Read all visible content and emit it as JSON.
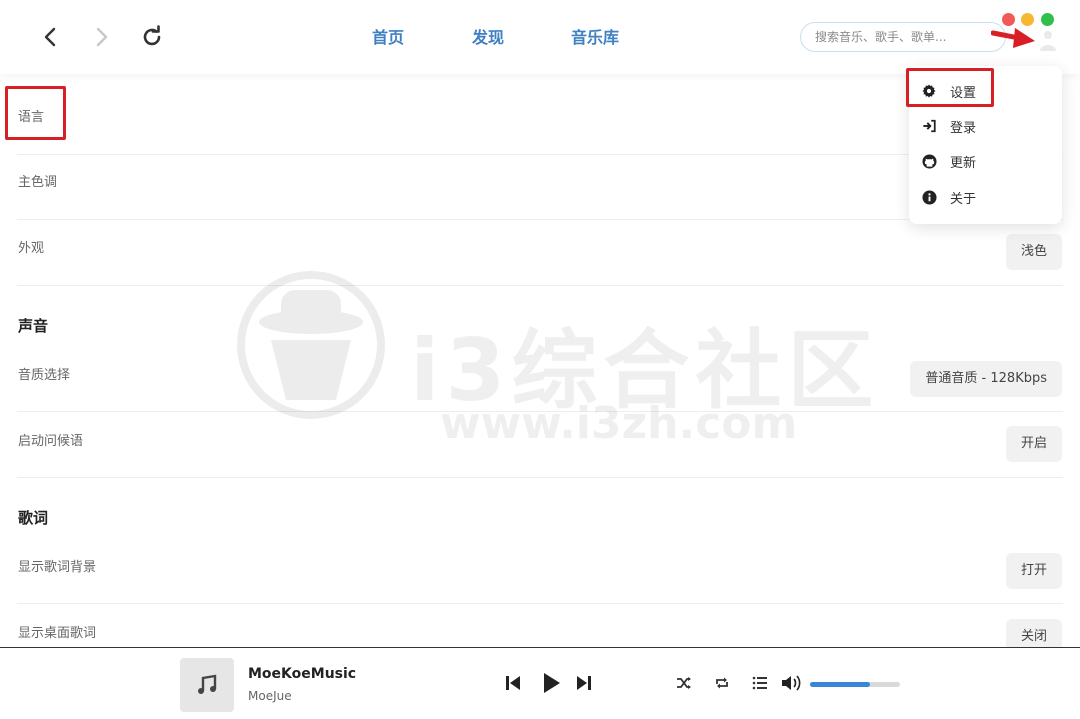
{
  "header": {
    "tabs": [
      "首页",
      "发现",
      "音乐库"
    ],
    "search_placeholder": "搜索音乐、歌手、歌单..."
  },
  "menu": {
    "items": [
      {
        "label": "设置",
        "icon": "gear-icon"
      },
      {
        "label": "登录",
        "icon": "login-icon"
      },
      {
        "label": "更新",
        "icon": "github-icon"
      },
      {
        "label": "关于",
        "icon": "info-icon"
      }
    ]
  },
  "settings": {
    "language_label": "语言",
    "theme_color_label": "主色调",
    "appearance_label": "外观",
    "appearance_value": "浅色",
    "sound_title": "声音",
    "quality_label": "音质选择",
    "quality_value": "普通音质 - 128Kbps",
    "greeting_label": "启动问候语",
    "greeting_value": "开启",
    "lyrics_title": "歌词",
    "lyrics_bg_label": "显示歌词背景",
    "lyrics_bg_value": "打开",
    "desktop_lyrics_label": "显示桌面歌词",
    "desktop_lyrics_value": "关闭"
  },
  "watermark": {
    "text": "i3综合社区",
    "url": "www.i3zh.com"
  },
  "player": {
    "title": "MoeKoeMusic",
    "artist": "MoeJue",
    "volume": 0.67
  },
  "colors": {
    "accent": "#3f7fc4",
    "highlight_box": "#d91f26",
    "volume": "#3a86d6"
  }
}
